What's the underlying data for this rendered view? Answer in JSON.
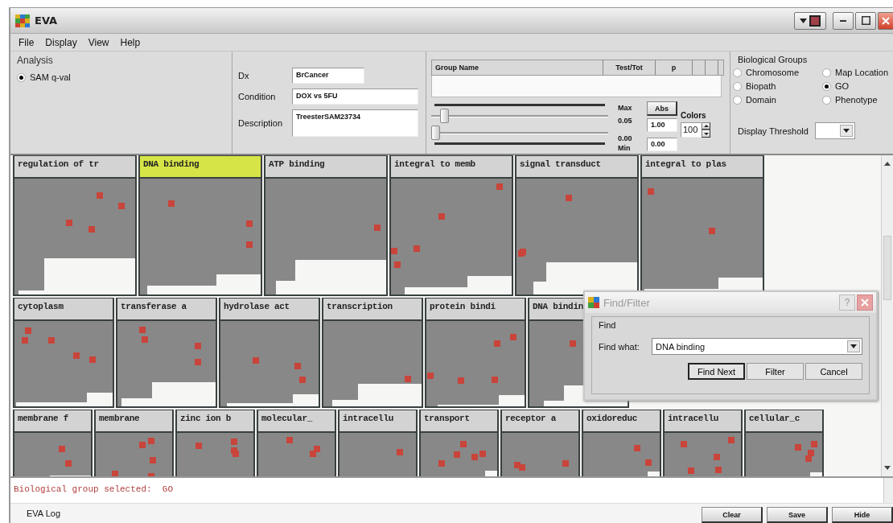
{
  "window": {
    "title": "EVA"
  },
  "menu": [
    "File",
    "Display",
    "View",
    "Help"
  ],
  "analysis": {
    "title": "Analysis",
    "options": [
      {
        "label": "SAM q-val",
        "selected": true
      }
    ]
  },
  "info": {
    "fields": [
      {
        "label": "Dx",
        "value": "BrCancer"
      },
      {
        "label": "Condition",
        "value": "DOX vs 5FU"
      },
      {
        "label": "Description",
        "value": "TreesterSAM23734"
      }
    ]
  },
  "group_table": {
    "columns": [
      "Group Name",
      "Test/Tot",
      "p"
    ]
  },
  "range": {
    "max_label": "Max",
    "max_value": "0.05",
    "min_value": "0.00",
    "min_label": "Min",
    "max_slider": {
      "level": 0.05
    },
    "min_slider": {
      "level": 0
    },
    "abs_button": "Abs",
    "abs_max": "1.00",
    "abs_min": "0.00",
    "colors_label": "Colors",
    "colors_value": "100"
  },
  "biological_groups": {
    "title": "Biological Groups",
    "options": [
      {
        "label": "Chromosome",
        "selected": false
      },
      {
        "label": "Map Location",
        "selected": false
      },
      {
        "label": "Biopath",
        "selected": false
      },
      {
        "label": "GO",
        "selected": true
      },
      {
        "label": "Domain",
        "selected": false
      },
      {
        "label": "Phenotype",
        "selected": false
      }
    ],
    "threshold_label": "Display Threshold"
  },
  "tile_rows": [
    [
      {
        "label": "regulation of tr",
        "selected": false
      },
      {
        "label": "DNA binding",
        "selected": true
      },
      {
        "label": "ATP binding",
        "selected": false
      },
      {
        "label": "integral to memb",
        "selected": false
      },
      {
        "label": "signal transduct",
        "selected": false
      },
      {
        "label": "integral to plas",
        "selected": false
      }
    ],
    [
      {
        "label": "cytoplasm",
        "selected": false
      },
      {
        "label": "transferase a",
        "selected": false
      },
      {
        "label": "hydrolase act",
        "selected": false
      },
      {
        "label": "transcription",
        "selected": false
      },
      {
        "label": "protein bindi",
        "selected": false
      },
      {
        "label": "DNA bindin",
        "selected": false
      }
    ],
    [
      {
        "label": "membrane f",
        "selected": false
      },
      {
        "label": "membrane",
        "selected": false
      },
      {
        "label": "zinc ion b",
        "selected": false
      },
      {
        "label": "molecular_",
        "selected": false
      },
      {
        "label": "intracellu",
        "selected": false
      },
      {
        "label": "transport",
        "selected": false
      },
      {
        "label": "receptor a",
        "selected": false
      },
      {
        "label": "oxidoreduc",
        "selected": false
      },
      {
        "label": "intracellu",
        "selected": false
      },
      {
        "label": "cellular_c",
        "selected": false
      }
    ]
  ],
  "log": {
    "message": "Biological group selected:  GO",
    "label": "EVA Log",
    "buttons": [
      "Clear",
      "Save",
      "Hide"
    ]
  },
  "dialog": {
    "title": "Find/Filter",
    "help": "?",
    "group": "Find",
    "field_label": "Find what:",
    "value": "DNA binding",
    "buttons": [
      {
        "label": "Find Next",
        "default": true
      },
      {
        "label": "Filter",
        "default": false
      },
      {
        "label": "Cancel",
        "default": false
      }
    ]
  }
}
